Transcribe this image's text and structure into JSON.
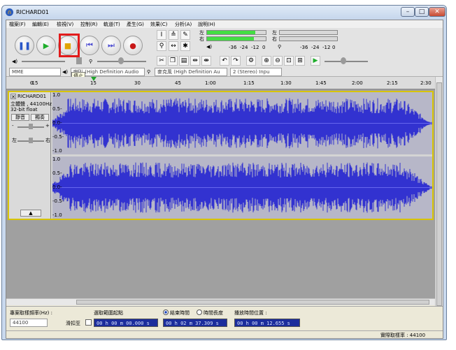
{
  "window": {
    "title": "RICHARD01",
    "btn_min": "–",
    "btn_max": "□",
    "btn_close": "✕"
  },
  "menu": [
    "檔案(F)",
    "編輯(E)",
    "檢視(V)",
    "控制(R)",
    "軌道(T)",
    "產生(G)",
    "效果(C)",
    "分析(A)",
    "說明(H)"
  ],
  "transport": {
    "pause_icon": "pause-icon",
    "play_icon": "play-icon",
    "stop_icon": "stop-icon",
    "skip_start_icon": "skip-start-icon",
    "skip_end_icon": "skip-end-icon",
    "record_icon": "record-icon",
    "stop_tooltip": "停止"
  },
  "meters": {
    "left_label": "左",
    "right_label": "右",
    "play_ticks": [
      "-36",
      "-24",
      "-12",
      "0"
    ],
    "rec_ticks": [
      "-36",
      "-24",
      "-12",
      "0"
    ],
    "left_level": 0.82,
    "right_level": 0.8
  },
  "mixer": {
    "device_host": "MME",
    "output_device": "喇叭 (High Definition Audio",
    "input_device": "麥克風 (High Definition Au",
    "channels": "2 (Stereo) Inpu"
  },
  "ruler": {
    "ticks": [
      "-15",
      "0",
      "15",
      "30",
      "45",
      "1:00",
      "1:15",
      "1:30",
      "1:45",
      "2:00",
      "2:15",
      "2:30"
    ]
  },
  "track": {
    "name": "RICHARD01",
    "info1": "立體聲 , 44100Hz",
    "info2": "32-bit float",
    "mute": "靜音",
    "solo": "獨奏",
    "gain_minus": "-",
    "gain_plus": "+",
    "pan_left": "左",
    "pan_right": "右",
    "y_ticks": [
      "1.0",
      "0.5-",
      "0.0-",
      "-0.5-",
      "-1.0"
    ],
    "collapse_icon": "collapse-arrow-icon"
  },
  "selection": {
    "rate_label": "專案取樣頻率(Hz) :",
    "rate_value": "44100",
    "snap_label": "滑扣至",
    "sel_start_label": "選取範圍起點",
    "end_radio": "結束時間",
    "length_radio": "時間長度",
    "start_value": "00 h 00 m 00.000 s",
    "end_value": "00 h 02 m 37.309 s",
    "pos_label": "播放時間位置 :",
    "pos_value": "00 h 00 m 12.655 s"
  },
  "status": {
    "rate_text": "實際取樣率 : 44100"
  }
}
